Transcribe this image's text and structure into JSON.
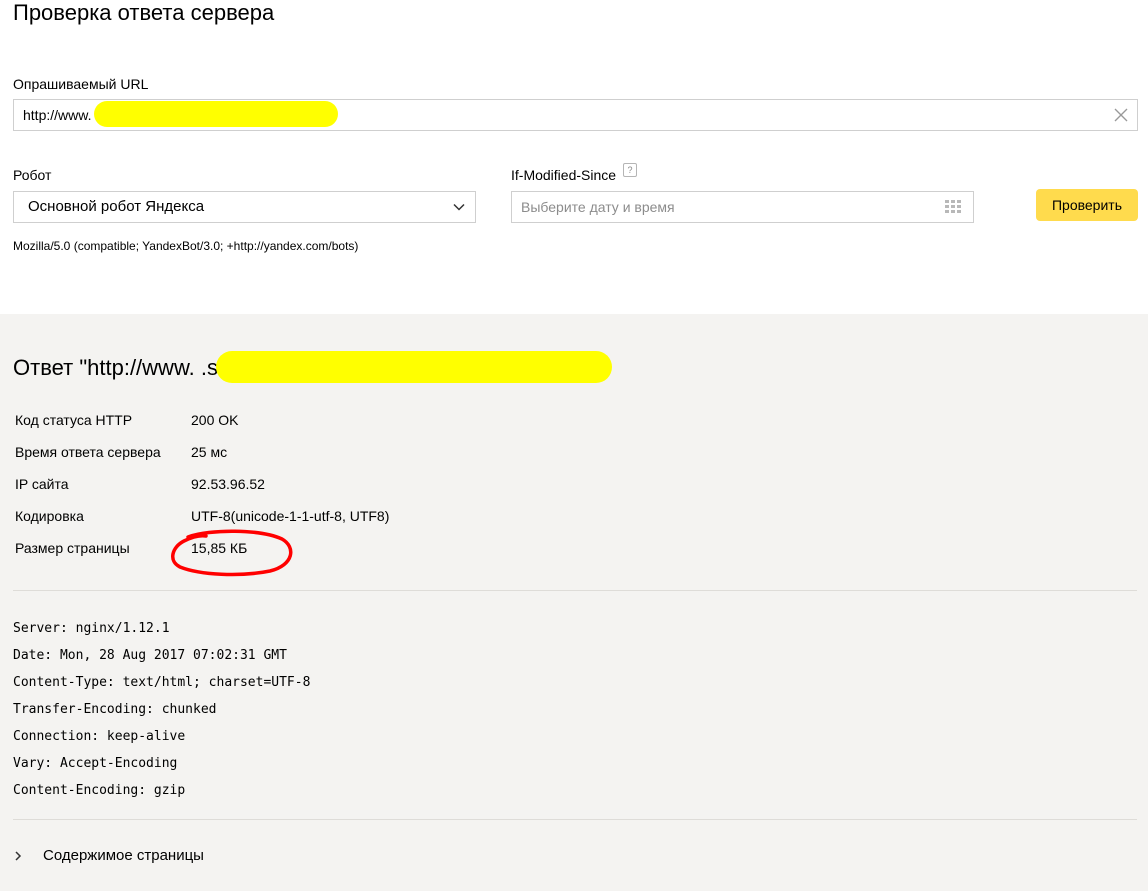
{
  "page_title": "Проверка ответа сервера",
  "url_field": {
    "label": "Опрашиваемый URL",
    "value": "http://www.                                                  .shtml",
    "clear_icon": "close-icon"
  },
  "robot_field": {
    "label": "Робот",
    "selected": "Основной робот Яндекса",
    "user_agent": "Mozilla/5.0 (compatible; YandexBot/3.0; +http://yandex.com/bots)"
  },
  "date_field": {
    "label": "If-Modified-Since",
    "help_glyph": "?",
    "placeholder": "Выберите дату и время"
  },
  "check_button": {
    "label": "Проверить"
  },
  "result": {
    "title": "Ответ \"http://www.                                                              .shtml\" → Основной робот Яндекса",
    "rows": [
      {
        "key": "Код статуса HTTP",
        "value": "200 OK"
      },
      {
        "key": "Время ответа сервера",
        "value": "25 мс"
      },
      {
        "key": "IP сайта",
        "value": "92.53.96.52"
      },
      {
        "key": "Кодировка",
        "value": "UTF-8(unicode-1-1-utf-8, UTF8)"
      },
      {
        "key": "Размер страницы",
        "value": "15,85 КБ"
      }
    ],
    "headers": [
      "Server: nginx/1.12.1",
      "Date: Mon, 28 Aug 2017 07:02:31 GMT",
      "Content-Type: text/html; charset=UTF-8",
      "Transfer-Encoding: chunked",
      "Connection: keep-alive",
      "Vary: Accept-Encoding",
      "Content-Encoding: gzip"
    ],
    "content_toggle": "Содержимое страницы"
  },
  "colors": {
    "accent_button": "#ffdb4d",
    "result_background": "#f4f3f1",
    "redaction_highlight": "#ffff00",
    "annotation_red": "#ff0000"
  }
}
